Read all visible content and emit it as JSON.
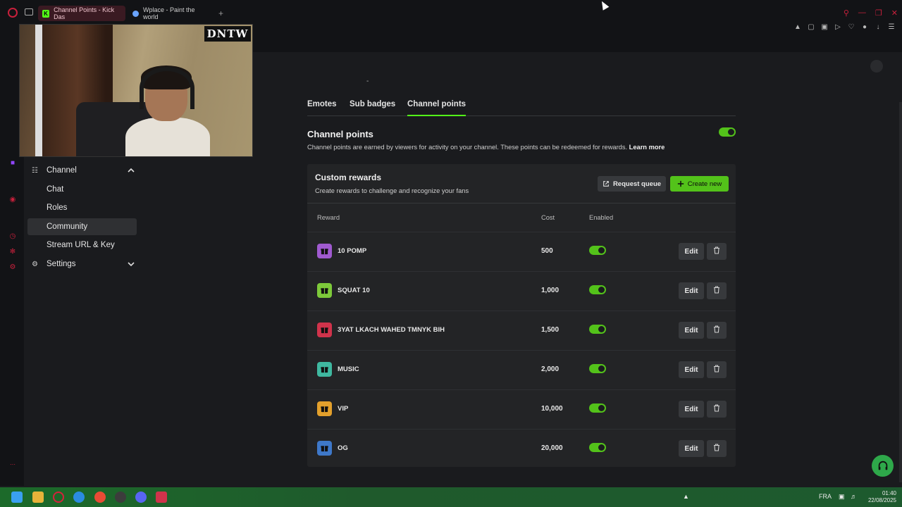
{
  "browser": {
    "tabs": [
      {
        "title": "Channel Points - Kick Das",
        "favicon": "kick-logo-icon",
        "active": true
      },
      {
        "title": "Wplace - Paint the world",
        "favicon": "globe-icon",
        "active": false
      }
    ],
    "new_tab_label": "+"
  },
  "webcam": {
    "overlay_logo_text": "DNTW"
  },
  "left_nav": {
    "items": [
      {
        "label": "Channel",
        "icon": "channel-icon",
        "expanded": true
      },
      {
        "label": "Chat"
      },
      {
        "label": "Roles"
      },
      {
        "label": "Community",
        "active": true
      },
      {
        "label": "Stream URL & Key"
      },
      {
        "label": "Settings",
        "icon": "gear-icon",
        "expanded": false
      }
    ]
  },
  "page": {
    "dash": "-",
    "tabs": [
      "Emotes",
      "Sub badges",
      "Channel points"
    ],
    "active_tab": "Channel points",
    "channel_points": {
      "title": "Channel points",
      "description": "Channel points are earned by viewers for activity on your channel. These points can be redeemed for rewards.",
      "learn_more": "Learn more",
      "enabled": true
    },
    "custom_rewards": {
      "title": "Custom rewards",
      "subtitle": "Create rewards to challenge and recognize your fans",
      "request_queue_label": "Request queue",
      "create_new_label": "Create new",
      "columns": {
        "reward": "Reward",
        "cost": "Cost",
        "enabled": "Enabled"
      },
      "edit_label": "Edit",
      "rows": [
        {
          "name": "10 POMP",
          "cost": "500",
          "enabled": true,
          "color": "#a05ad0"
        },
        {
          "name": "SQUAT 10",
          "cost": "1,000",
          "enabled": true,
          "color": "#7dc93a"
        },
        {
          "name": "3YAT LKACH WAHED TMNYK BIH",
          "cost": "1,500",
          "enabled": true,
          "color": "#d0334b"
        },
        {
          "name": "MUSIC",
          "cost": "2,000",
          "enabled": true,
          "color": "#3fb8a0"
        },
        {
          "name": "VIP",
          "cost": "10,000",
          "enabled": true,
          "color": "#e3a02c"
        },
        {
          "name": "OG",
          "cost": "20,000",
          "enabled": true,
          "color": "#3e78c9"
        }
      ]
    }
  },
  "taskbar": {
    "language": "FRA",
    "time": "01:40",
    "date": "22/08/2025"
  },
  "colors": {
    "accent": "#53fc18",
    "toggle_on": "#53c21a",
    "opera_red": "#c8203c"
  }
}
